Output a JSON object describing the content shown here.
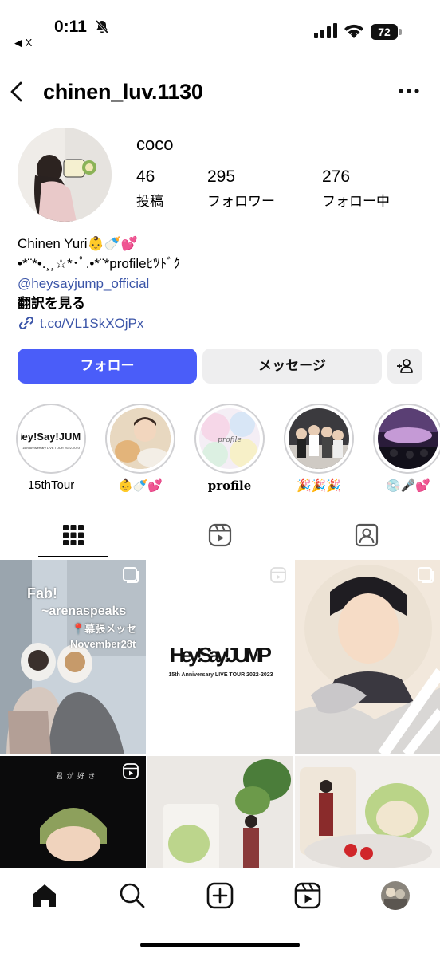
{
  "status_bar": {
    "time": "0:11",
    "back_app": "◀ X",
    "battery": "72"
  },
  "header": {
    "username": "chinen_luv.1130"
  },
  "profile": {
    "display_name": "coco",
    "stats": [
      {
        "value": "46",
        "label": "投稿"
      },
      {
        "value": "295",
        "label": "フォロワー"
      },
      {
        "value": "276",
        "label": "フォロー中"
      }
    ],
    "bio": {
      "line1": "Chinen Yuri👶🍼💕",
      "line2": "•*¨*•.¸¸☆*･ﾟ.•*¨*profileﾋﾂﾄﾞｸ",
      "mention": "@heysayjump_official",
      "translate": "翻訳を見る",
      "link": "t.co/VL1SkXOjPx"
    }
  },
  "actions": {
    "follow": "フォロー",
    "message": "メッセージ"
  },
  "highlights": [
    {
      "label": "15thTour"
    },
    {
      "label": "👶🍼💕"
    },
    {
      "label": "profile"
    },
    {
      "label": "🎉🎉🎉"
    },
    {
      "label": "💿🎤💕"
    }
  ],
  "highlight_texts": {
    "logo": "Hey!Say!JUMP",
    "tour": "15th Anniversary LIVE TOUR 2022-2023",
    "profile_script": "profile"
  },
  "grid": {
    "post1": {
      "title": "Fab!",
      "subtitle": "~arenaspeaks",
      "place": "📍幕張メッセ",
      "date": "November28t"
    },
    "post2": {
      "logo": "Hey!Say!JUMP",
      "caption": "15th Anniversary LIVE TOUR 2022-2023"
    },
    "post4": {
      "caption": "君 が 好 き"
    }
  },
  "colors": {
    "follow_button": "#4a5df9",
    "secondary_button": "#eeeeef",
    "link": "#3b55a8"
  }
}
